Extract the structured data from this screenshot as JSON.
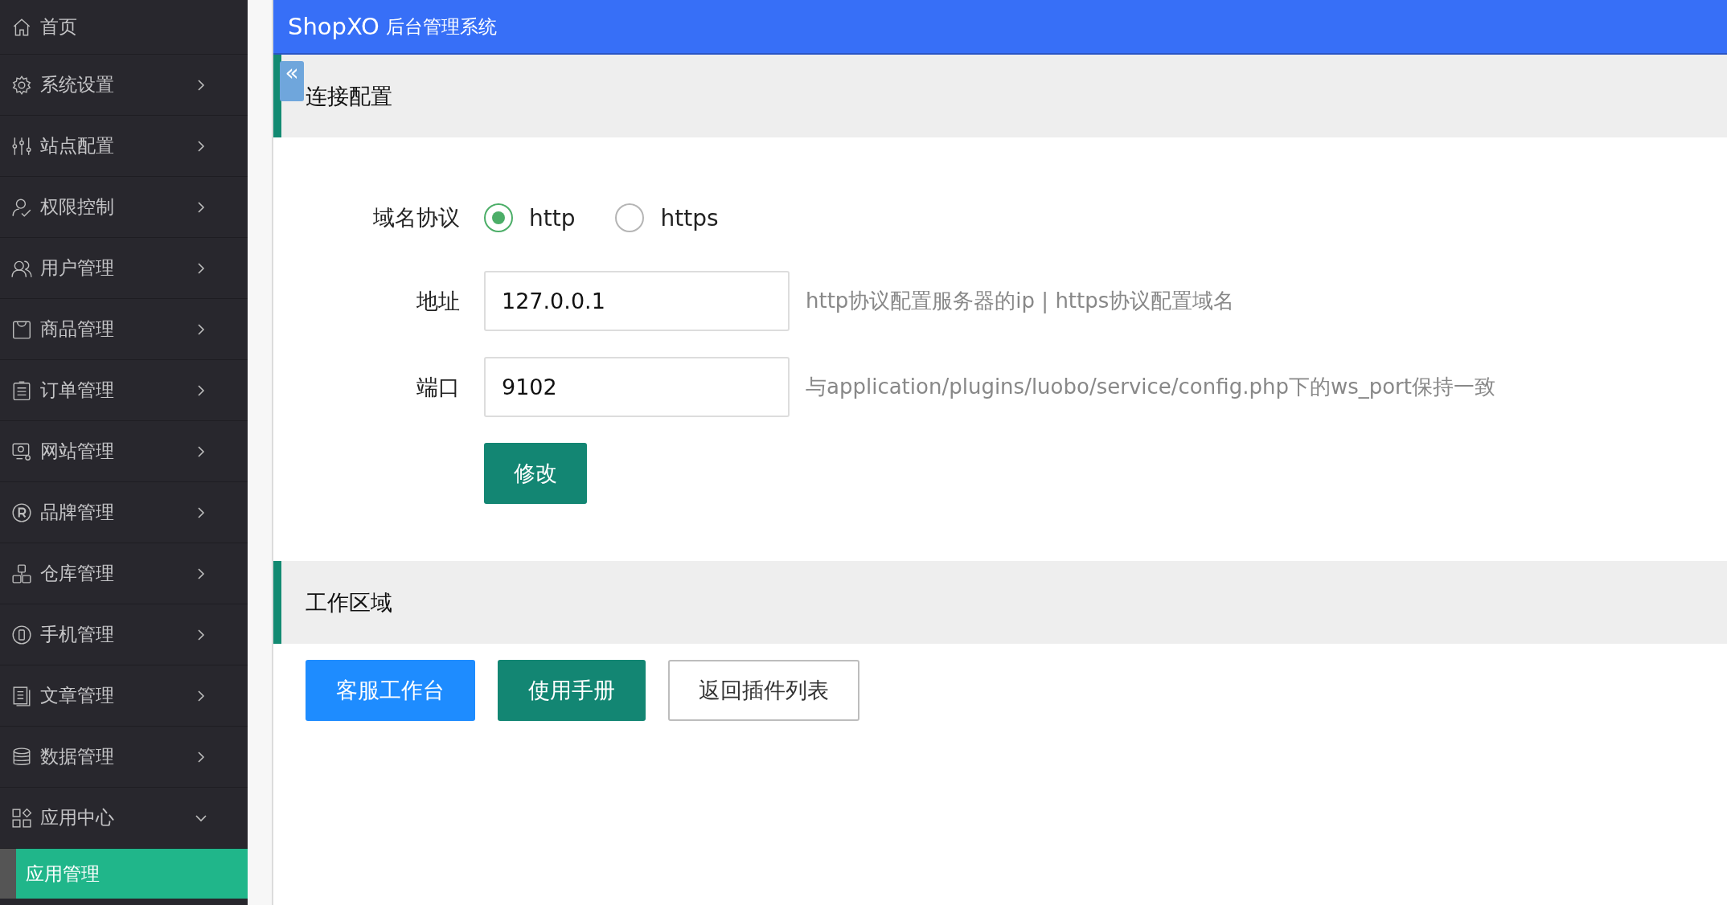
{
  "sidebar": {
    "items": [
      {
        "label": "首页",
        "kind": "link"
      },
      {
        "label": "系统设置",
        "kind": "group",
        "expanded": false
      },
      {
        "label": "站点配置",
        "kind": "group",
        "expanded": false
      },
      {
        "label": "权限控制",
        "kind": "group",
        "expanded": false
      },
      {
        "label": "用户管理",
        "kind": "group",
        "expanded": false
      },
      {
        "label": "商品管理",
        "kind": "group",
        "expanded": false
      },
      {
        "label": "订单管理",
        "kind": "group",
        "expanded": false
      },
      {
        "label": "网站管理",
        "kind": "group",
        "expanded": false
      },
      {
        "label": "品牌管理",
        "kind": "group",
        "expanded": false
      },
      {
        "label": "仓库管理",
        "kind": "group",
        "expanded": false
      },
      {
        "label": "手机管理",
        "kind": "group",
        "expanded": false
      },
      {
        "label": "文章管理",
        "kind": "group",
        "expanded": false
      },
      {
        "label": "数据管理",
        "kind": "group",
        "expanded": false
      },
      {
        "label": "应用中心",
        "kind": "group",
        "expanded": true,
        "children": [
          {
            "label": "应用管理",
            "selected": true
          }
        ]
      }
    ]
  },
  "header": {
    "brand": "ShopXO",
    "subtitle": "后台管理系统"
  },
  "collapse_button": {
    "label": "«"
  },
  "sections": [
    {
      "title": "连接配置",
      "kind": "form",
      "fields": [
        {
          "kind": "radio",
          "label": "域名协议",
          "options": [
            {
              "label": "http",
              "selected": true
            },
            {
              "label": "https",
              "selected": false
            }
          ]
        },
        {
          "kind": "input",
          "label": "地址",
          "value": "127.0.0.1",
          "hint": "http协议配置服务器的ip | https协议配置域名"
        },
        {
          "kind": "input",
          "label": "端口",
          "value": "9102",
          "hint": "与application/plugins/luobo/service/config.php下的ws_port保持一致"
        }
      ],
      "submit": "修改"
    },
    {
      "title": "工作区域",
      "kind": "buttons",
      "buttons": [
        {
          "label": "客服工作台",
          "kind": "primary"
        },
        {
          "label": "使用手册",
          "kind": "success"
        },
        {
          "label": "返回插件列表",
          "kind": "default"
        }
      ]
    }
  ]
}
